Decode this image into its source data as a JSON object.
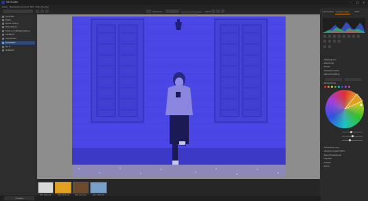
{
  "window": {
    "title": "NX Studio"
  },
  "menu": [
    "Datei",
    "Bearbeiten",
    "Ansicht",
    "Bild",
    "Hilfe",
    "Fenster"
  ],
  "toolbar": {
    "left_label": "Vorschau",
    "right_label": "Speichern",
    "zoom": "100 %"
  },
  "sidebar": {
    "items": [
      {
        "label": "Favoriten",
        "active": false
      },
      {
        "label": "Bilder",
        "active": false
      },
      {
        "label": "Neuer Ordner",
        "active": false
      },
      {
        "label": "Bibliotheken",
        "active": false
      },
      {
        "label": "Fotos und Bildaufnahmen",
        "active": false
      },
      {
        "label": "Laufwerk",
        "active": false
      },
      {
        "label": "Aufnahmen",
        "active": false
      },
      {
        "label": "Hochladen",
        "active": true
      },
      {
        "label": "NX Fi",
        "active": false
      },
      {
        "label": "Netzwerk",
        "active": false
      }
    ]
  },
  "right_panel": {
    "tabs": [
      "Information",
      "Anpassungen",
      "Hilfe"
    ],
    "active_tab": "Anpassungen",
    "sections": [
      "Weißabgleich",
      "Belichtung",
      "Farben",
      "Tonwertkorrektur",
      "Aktive D-Lighting",
      "Farbkontrolle",
      "Scharfzeichnung",
      "Verzeichnungskorrektur",
      "Rauschreduzierung",
      "Vignette",
      "Schärfe",
      "Kurve",
      "Farbton"
    ],
    "color_dots": [
      "#e03030",
      "#e08a1e",
      "#e0d020",
      "#30c030",
      "#20c0c0",
      "#3050e0",
      "#a040e0",
      "#e040a0"
    ]
  },
  "filmstrip": {
    "thumbs": [
      {
        "label": "IMG_0001.jpg",
        "color": "#d8d8d8"
      },
      {
        "label": "IMG_0002.jpg",
        "color": "#e0a020",
        "selected": true
      },
      {
        "label": "IMG_0003.jpg",
        "color": "#6b4a30"
      },
      {
        "label": "IMG_0004.jpg",
        "color": "#7aa0c8"
      }
    ]
  },
  "statusbar": {
    "left": "Vorgabe"
  },
  "photo_color": "#4a47e6"
}
